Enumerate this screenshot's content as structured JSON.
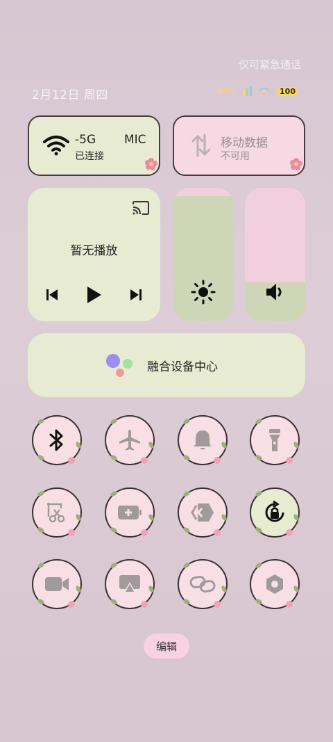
{
  "status_bar": {
    "emergency_text": "仅可紧急通话",
    "date_text": "2月12日 周四",
    "nfc_label": "NFC",
    "battery_level": "100"
  },
  "wifi_tile": {
    "ssid_partial": "-5G",
    "ssid_tail": "MIC",
    "status": "已连接"
  },
  "data_tile": {
    "title": "移动数据",
    "status": "不可用"
  },
  "media": {
    "status": "暂无播放"
  },
  "brightness_level": 0.94,
  "volume_level": 0.29,
  "fusion_center": {
    "label": "融合设备中心"
  },
  "toggles": [
    {
      "icon": "bluetooth-icon",
      "on": false
    },
    {
      "icon": "airplane-icon",
      "on": false
    },
    {
      "icon": "bell-icon",
      "on": false
    },
    {
      "icon": "flashlight-icon",
      "on": false
    },
    {
      "icon": "screenshot-icon",
      "on": false
    },
    {
      "icon": "battery-saver-icon",
      "on": false
    },
    {
      "icon": "direct-connect-icon",
      "on": false
    },
    {
      "icon": "rotation-lock-icon",
      "on": true
    },
    {
      "icon": "screen-record-icon",
      "on": false
    },
    {
      "icon": "screen-cast-icon",
      "on": false
    },
    {
      "icon": "link-icon",
      "on": false
    },
    {
      "icon": "settings-hex-icon",
      "on": false
    }
  ],
  "edit_button": {
    "label": "编辑"
  },
  "colors": {
    "green_tile": "#e6ebd2",
    "pink_tile": "#f6d9e3",
    "slider_green": "#cdd6b7",
    "slider_pink": "#f2cfdc"
  }
}
